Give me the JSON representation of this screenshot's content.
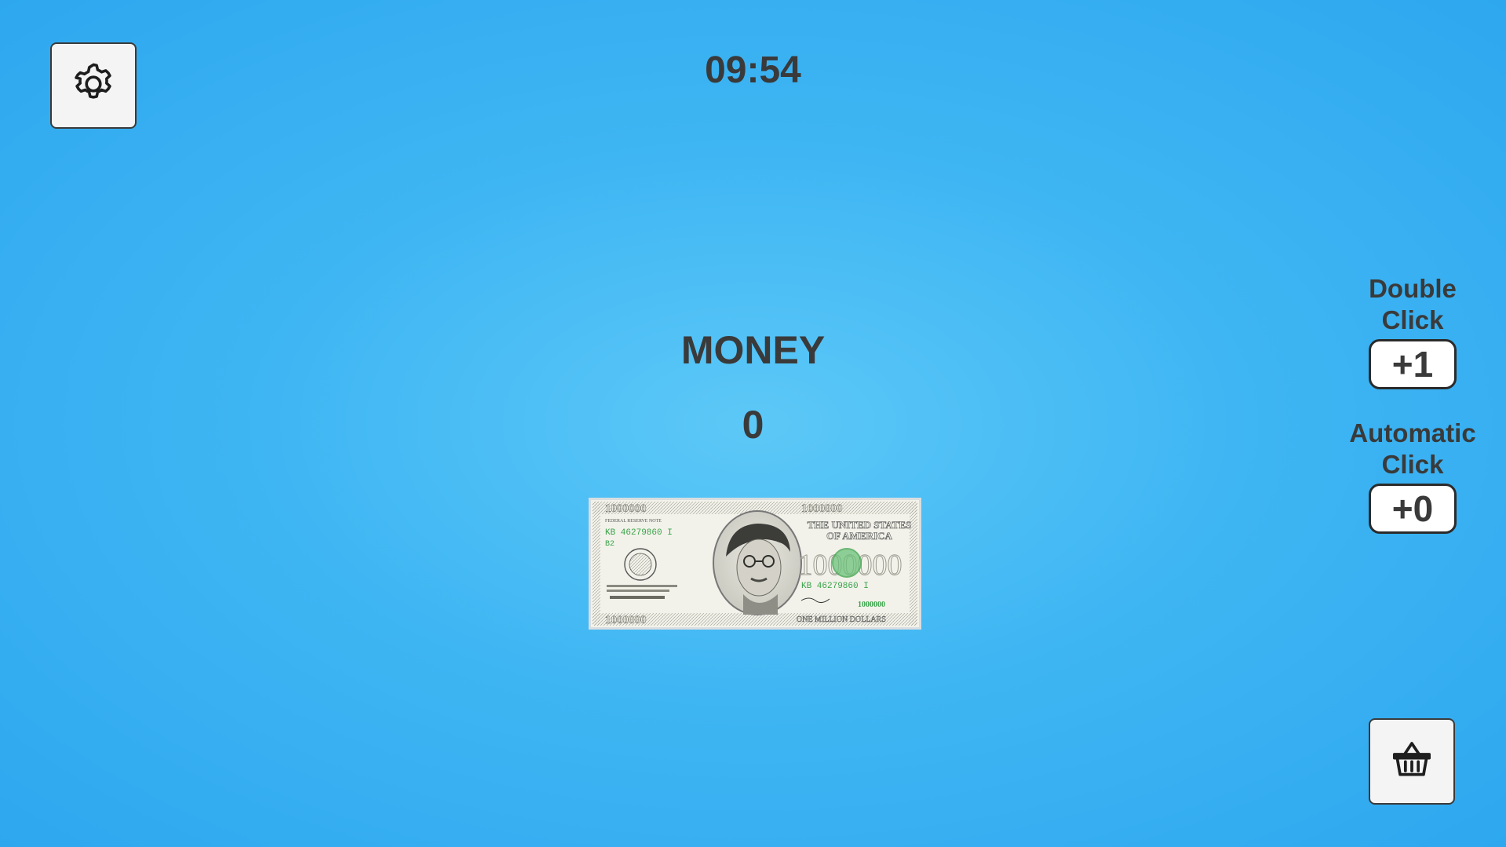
{
  "timer": "09:54",
  "money": {
    "title": "MONEY",
    "value": "0"
  },
  "upgrades": {
    "double_click": {
      "label_line1": "Double",
      "label_line2": "Click",
      "value": "+1"
    },
    "automatic_click": {
      "label_line1": "Automatic",
      "label_line2": "Click",
      "value": "+0"
    }
  },
  "banknote": {
    "top_left_denomination": "1000000",
    "top_right_denomination": "1000000",
    "header": "FEDERAL RESERVE NOTE",
    "country_line1": "THE UNITED STATES",
    "country_line2": "OF AMERICA",
    "serial": "KB 46279860 I",
    "series_code": "B2",
    "center_value": "1000000",
    "bottom_left_denomination": "1000000",
    "bottom_right_denomination": "1000000",
    "bottom_text": "ONE MILLION DOLLARS"
  },
  "icons": {
    "settings": "gear-icon",
    "shop": "basket-icon"
  },
  "colors": {
    "background": "#3fb6f3",
    "text": "#3a3a3a",
    "note_green": "#3aa34a"
  }
}
